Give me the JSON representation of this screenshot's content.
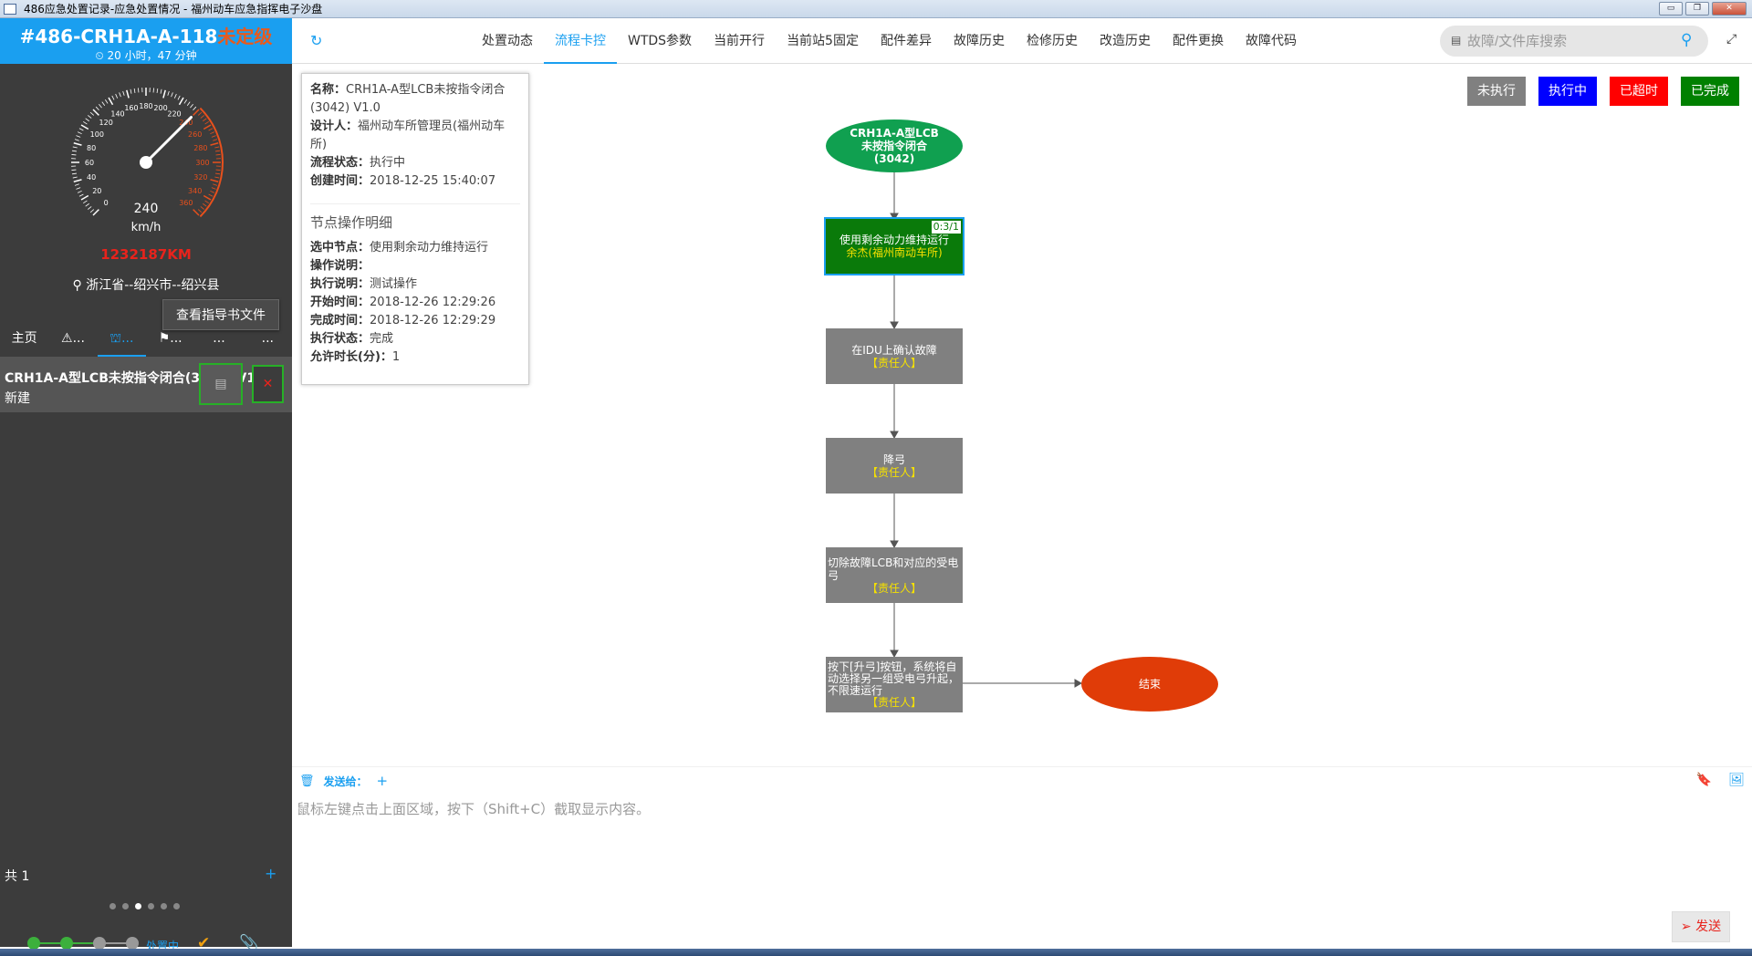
{
  "window": {
    "title": "486应急处置记录-应急处置情况 - 福州动车应急指挥电子沙盘",
    "controls": [
      "▭",
      "❐",
      "✕"
    ]
  },
  "incident": {
    "code": "#486-CRH1A-A-118",
    "level": "未定级",
    "duration": "⏲ 20 小时，47 分钟",
    "speed_value": "240",
    "speed_unit": "km/h",
    "gauge_max": 360,
    "gauge_ticks": [
      "0",
      "20",
      "40",
      "60",
      "80",
      "100",
      "120",
      "140",
      "160",
      "180",
      "200",
      "220",
      "240",
      "260",
      "280",
      "300",
      "320",
      "340",
      "360"
    ],
    "mileage": "1232187KM",
    "location": "浙江省--绍兴市--绍兴县"
  },
  "left_tabs": [
    {
      "label": "主页"
    },
    {
      "label": "⚠..."
    },
    {
      "label": "⛫..."
    },
    {
      "label": "⚑..."
    },
    {
      "label": "..."
    },
    {
      "label": "..."
    }
  ],
  "tooltip": "查看指导书文件",
  "flow_item": {
    "name": "CRH1A-A型LCB未按指令闭合(3042) V1.0",
    "status": "新建",
    "open_label": "▤",
    "delete_label": "✕"
  },
  "list_total": "共 1",
  "list_add": "+",
  "progress": {
    "label": "处置中",
    "done_steps": 2,
    "total_steps": 4
  },
  "topnav": {
    "tabs": [
      "处置动态",
      "流程卡控",
      "WTDS参数",
      "当前开行",
      "当前站5固定",
      "配件差异",
      "故障历史",
      "检修历史",
      "改造历史",
      "配件更换",
      "故障代码"
    ],
    "active_tab": 1,
    "search_placeholder": "故障/文件库搜索"
  },
  "info": {
    "name_label": "名称：",
    "name_value": "CRH1A-A型LCB未按指令闭合(3042) V1.0",
    "designer_label": "设计人：",
    "designer_value": "福州动车所管理员(福州动车所)",
    "state_label": "流程状态：",
    "state_value": "执行中",
    "created_label": "创建时间：",
    "created_value": "2018-12-25 15:40:07",
    "section_title": "节点操作明细",
    "selected_label": "选中节点：",
    "selected_value": "使用剩余动力维持运行",
    "op_desc_label": "操作说明：",
    "op_desc_value": "",
    "exec_desc_label": "执行说明：",
    "exec_desc_value": "测试操作",
    "start_label": "开始时间：",
    "start_value": "2018-12-26 12:29:26",
    "finish_label": "完成时间：",
    "finish_value": "2018-12-26 12:29:29",
    "exec_state_label": "执行状态：",
    "exec_state_value": "完成",
    "allowed_label": "允许时长(分)：",
    "allowed_value": "1"
  },
  "legend": [
    {
      "label": "未执行",
      "color": "#808080"
    },
    {
      "label": "执行中",
      "color": "#0000ff"
    },
    {
      "label": "已超时",
      "color": "#ff0000"
    },
    {
      "label": "已完成",
      "color": "#008000"
    }
  ],
  "flow_nodes": {
    "start": {
      "text": "CRH1A-A型LCB未按指令闭合(3042)",
      "color": "#10a050"
    },
    "n1": {
      "counter": "0:3/1",
      "text": "使用剩余动力维持运行",
      "resp": "余杰(福州南动车所)",
      "color": "#0a7a0a",
      "border": "#1a9ff0"
    },
    "n2": {
      "text": "在IDU上确认故障",
      "resp": "【责任人】",
      "color": "#808080"
    },
    "n3": {
      "text": "降弓",
      "resp": "【责任人】",
      "color": "#808080"
    },
    "n4": {
      "text": "切除故障LCB和对应的受电弓",
      "resp": "【责任人】",
      "color": "#808080"
    },
    "n5": {
      "text": "按下[升弓]按钮，系统将自动选择另一组受电弓升起，不限速运行",
      "resp": "【责任人】",
      "color": "#808080"
    },
    "end": {
      "text": "结束",
      "color": "#e03c08"
    }
  },
  "message": {
    "send_to_label": "发送给：",
    "placeholder": "鼠标左键点击上面区域，按下（Shift+C）截取显示内容。",
    "send_label": "发送"
  }
}
